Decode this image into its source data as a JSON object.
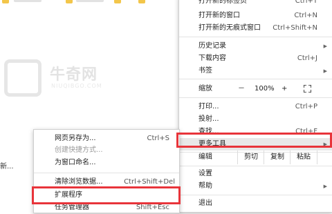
{
  "background": {
    "left_text": "新...",
    "watermark": {
      "name": "牛奇网",
      "sub": "NIUQIBGO.COM"
    }
  },
  "main_menu": {
    "items_top": [
      {
        "label": "打开新的窗口",
        "shortcut": "Ctrl+N"
      },
      {
        "label": "打开新的无痕式窗口",
        "shortcut": "Ctrl+Shift+N"
      }
    ],
    "items_history": [
      {
        "label": "历史记录",
        "shortcut": "",
        "submenu": true
      },
      {
        "label": "下载内容",
        "shortcut": "Ctrl+J",
        "submenu": false
      },
      {
        "label": "书签",
        "shortcut": "",
        "submenu": true
      }
    ],
    "zoom": {
      "label": "缩放",
      "minus": "－",
      "value": "100%",
      "plus": "+",
      "fullscreen_icon": "fullscreen-icon"
    },
    "items_print": [
      {
        "label": "打印...",
        "shortcut": "Ctrl+P"
      },
      {
        "label": "投射...",
        "shortcut": ""
      },
      {
        "label": "查找...",
        "shortcut": "Ctrl+F"
      }
    ],
    "more_tools": {
      "label": "更多工具"
    },
    "edit": {
      "label": "编辑",
      "cut": "剪切",
      "copy": "复制",
      "paste": "粘贴"
    },
    "settings": "设置",
    "help": "帮助",
    "exit": "退出"
  },
  "sub_menu": {
    "items": [
      {
        "label": "网页另存为...",
        "shortcut": "Ctrl+S",
        "disabled": false
      },
      {
        "label": "创建快捷方式...",
        "shortcut": "",
        "disabled": true
      },
      {
        "label": "为窗口命名...",
        "shortcut": "",
        "disabled": false
      },
      {
        "label": "清除浏览数据...",
        "shortcut": "Ctrl+Shift+Del",
        "disabled": false
      },
      {
        "label": "扩展程序",
        "shortcut": "",
        "disabled": false
      },
      {
        "label": "任务管理器",
        "shortcut": "Shift+Esc",
        "disabled": false
      }
    ]
  },
  "colors": {
    "highlight_box": "#e8343a",
    "hover_bg": "#e8e8e8"
  }
}
